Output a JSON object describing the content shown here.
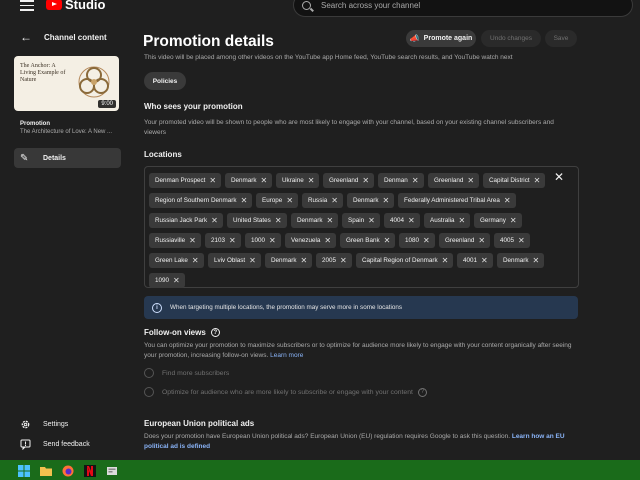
{
  "topbar": {
    "logo_text": "Studio",
    "search_placeholder": "Search across your channel"
  },
  "sidebar": {
    "back_label": "Channel content",
    "thumbnail": {
      "title_text": "The Anchor: A Living Example of Nature",
      "duration": "9:00"
    },
    "video_type": "Promotion",
    "video_title": "The Architecture of Love: A New ...",
    "nav_details": "Details",
    "settings": "Settings",
    "feedback": "Send feedback"
  },
  "header": {
    "title": "Promotion details",
    "promote_again": "Promote again",
    "undo_changes": "Undo changes",
    "save": "Save"
  },
  "intro": "This video will be placed among other videos on the YouTube app Home feed, YouTube search results, and YouTube watch next",
  "policies_chip": "Policies",
  "who_sees": {
    "heading": "Who sees your promotion",
    "text": "Your promoted video will be shown to people who are most likely to engage with your channel, based on your existing channel subscribers and viewers"
  },
  "locations": {
    "heading": "Locations",
    "chips": [
      "Denman Prospect",
      "Denmark",
      "Ukraine",
      "Greenland",
      "Denman",
      "Greenland",
      "Capital District",
      "Region of Southern Denmark",
      "Europe",
      "Russia",
      "Denmark",
      "Federally Administered Tribal Area",
      "Russian Jack Park",
      "United States",
      "Denmark",
      "Spain",
      "4004",
      "Australia",
      "Germany",
      "Russiaville",
      "2103",
      "1000",
      "Venezuela",
      "Green Bank",
      "1080",
      "Greenland",
      "4005",
      "Green Lake",
      "Lviv Oblast",
      "Denmark",
      "2005",
      "Capital Region of Denmark",
      "4001",
      "Denmark",
      "1090"
    ]
  },
  "info_banner": "When targeting multiple locations, the promotion may serve more in some locations",
  "follow_on": {
    "heading": "Follow-on views",
    "text": "You can optimize your promotion to maximize subscribers or to optimize for audience more likely to engage with your content organically after seeing your promotion, increasing follow-on views.",
    "learn_more": "Learn more",
    "option1": "Find more subscribers",
    "option2": "Optimize for audience who are more likely to subscribe or engage with your content"
  },
  "eu": {
    "heading": "European Union political ads",
    "text": "Does your promotion have European Union political ads? European Union (EU) regulation requires Google to ask this question.",
    "link": "Learn how an EU political ad is defined"
  },
  "colors": {
    "background": "#1f1f1f",
    "chip": "#3a3a3a",
    "info_banner": "#263850",
    "link": "#8ab4f8",
    "taskbar": "#1a6b1a",
    "brand_red": "#ff0000"
  }
}
